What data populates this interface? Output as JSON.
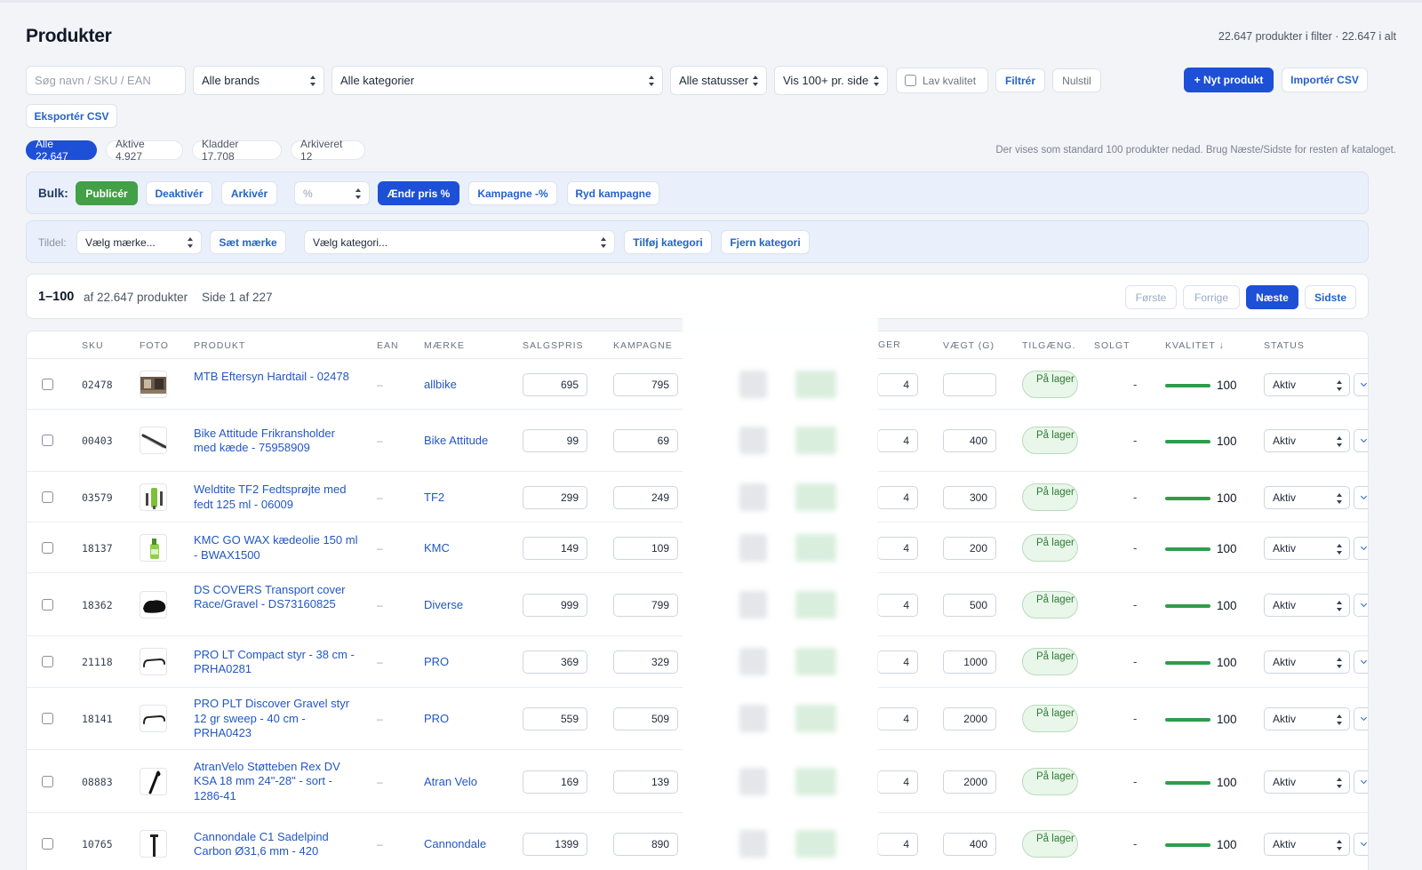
{
  "header": {
    "title": "Produkter",
    "count_summary": "22.647 produkter i filter · 22.647 i alt"
  },
  "filters": {
    "search_placeholder": "Søg navn / SKU / EAN",
    "brand": "Alle brands",
    "category": "Alle kategorier",
    "status": "Alle statusser",
    "per_page": "Vis 100+ pr. side",
    "low_quality_label": "Lav kvalitet",
    "filter_button": "Filtrér",
    "reset_button": "Nulstil",
    "new_product_button": "+ Nyt produkt",
    "import_button": "Importér CSV",
    "export_button": "Eksportér CSV"
  },
  "status_tabs": [
    {
      "label": "Alle 22.647",
      "active": true
    },
    {
      "label": "Aktive 4.927",
      "active": false
    },
    {
      "label": "Kladder 17.708",
      "active": false
    },
    {
      "label": "Arkiveret 12",
      "active": false
    }
  ],
  "hint": "Der vises som standard 100 produkter nedad. Brug Næste/Sidste for resten af kataloget.",
  "bulk": {
    "label": "Bulk:",
    "publish": "Publicér",
    "deactivate": "Deaktivér",
    "archive": "Arkivér",
    "unit": "%",
    "change_price": "Ændr pris %",
    "campaign": "Kampagne -%",
    "clear_campaign": "Ryd kampagne"
  },
  "assign": {
    "label": "Tildel:",
    "brand_select": "Vælg mærke...",
    "set_brand": "Sæt mærke",
    "category_select": "Vælg kategori...",
    "add_category": "Tilføj kategori",
    "remove_category": "Fjern kategori"
  },
  "pager": {
    "range": "1–100",
    "of_text": "af 22.647 produkter",
    "page_text": "Side 1 af 227",
    "first": "Første",
    "prev": "Forrige",
    "next": "Næste",
    "last": "Sidste"
  },
  "columns": {
    "sku": "SKU",
    "photo": "FOTO",
    "product": "PRODUKT",
    "ean": "EAN",
    "brand": "MÆRKE",
    "price": "SALGSPRIS",
    "campaign": "KAMPAGNE",
    "stock": "GER",
    "weight": "VÆGT (G)",
    "availability": "TILGÆNG.",
    "sold": "SOLGT",
    "quality": "KVALITET ↓",
    "status": "STATUS"
  },
  "rows": [
    {
      "sku": "02478",
      "name": "MTB Eftersyn Hardtail - 02478",
      "ean": "–",
      "brand": "allbike",
      "price": "695",
      "campaign": "795",
      "stock": "4",
      "weight": "",
      "availability": "På lager",
      "sold": "-",
      "quality": "100",
      "quality_level": 1.0,
      "status": "Aktiv",
      "photo_icon": "service-photo"
    },
    {
      "sku": "00403",
      "name": "Bike Attitude Frikransholder med kæde - 75958909",
      "ean": "–",
      "brand": "Bike Attitude",
      "price": "99",
      "campaign": "69",
      "stock": "4",
      "weight": "400",
      "availability": "På lager",
      "sold": "-",
      "quality": "100",
      "quality_level": 1.0,
      "status": "Aktiv",
      "photo_icon": "chain-whip-photo"
    },
    {
      "sku": "03579",
      "name": "Weldtite TF2 Fedtsprøjte med fedt 125 ml - 06009",
      "ean": "–",
      "brand": "TF2",
      "price": "299",
      "campaign": "249",
      "stock": "4",
      "weight": "300",
      "availability": "På lager",
      "sold": "-",
      "quality": "100",
      "quality_level": 1.0,
      "status": "Aktiv",
      "photo_icon": "grease-gun-photo"
    },
    {
      "sku": "18137",
      "name": "KMC GO WAX kædeolie 150 ml - BWAX1500",
      "ean": "–",
      "brand": "KMC",
      "price": "149",
      "campaign": "109",
      "stock": "4",
      "weight": "200",
      "availability": "På lager",
      "sold": "-",
      "quality": "100",
      "quality_level": 1.0,
      "status": "Aktiv",
      "photo_icon": "oil-bottle-photo"
    },
    {
      "sku": "18362",
      "name": "DS COVERS Transport cover Race/Gravel - DS73160825",
      "ean": "–",
      "brand": "Diverse",
      "price": "999",
      "campaign": "799",
      "stock": "4",
      "weight": "500",
      "availability": "På lager",
      "sold": "-",
      "quality": "100",
      "quality_level": 1.0,
      "status": "Aktiv",
      "photo_icon": "bike-cover-photo"
    },
    {
      "sku": "21118",
      "name": "PRO LT Compact styr - 38 cm - PRHA0281",
      "ean": "–",
      "brand": "PRO",
      "price": "369",
      "campaign": "329",
      "stock": "4",
      "weight": "1000",
      "availability": "På lager",
      "sold": "-",
      "quality": "100",
      "quality_level": 1.0,
      "status": "Aktiv",
      "photo_icon": "handlebar-photo"
    },
    {
      "sku": "18141",
      "name": "PRO PLT Discover Gravel styr 12 gr sweep - 40 cm - PRHA0423",
      "ean": "–",
      "brand": "PRO",
      "price": "559",
      "campaign": "509",
      "stock": "4",
      "weight": "2000",
      "availability": "På lager",
      "sold": "-",
      "quality": "100",
      "quality_level": 1.0,
      "status": "Aktiv",
      "photo_icon": "handlebar-photo"
    },
    {
      "sku": "08883",
      "name": "AtranVelo Støtteben Rex DV KSA 18 mm 24\"-28\" - sort - 1286-41",
      "ean": "–",
      "brand": "Atran Velo",
      "price": "169",
      "campaign": "139",
      "stock": "4",
      "weight": "2000",
      "availability": "På lager",
      "sold": "-",
      "quality": "100",
      "quality_level": 1.0,
      "status": "Aktiv",
      "photo_icon": "kickstand-photo"
    },
    {
      "sku": "10765",
      "name": "Cannondale C1 Sadelpind Carbon Ø31,6 mm - 420",
      "ean": "–",
      "brand": "Cannondale",
      "price": "1399",
      "campaign": "890",
      "stock": "4",
      "weight": "400",
      "availability": "På lager",
      "sold": "-",
      "quality": "100",
      "quality_level": 1.0,
      "status": "Aktiv",
      "photo_icon": "seatpost-photo"
    }
  ],
  "colors": {
    "accent": "#1d4fd7",
    "link": "#2257c4",
    "publish": "#43a047",
    "quality_bar": "#2e9d4b",
    "stock_badge": "#2e7d32"
  }
}
